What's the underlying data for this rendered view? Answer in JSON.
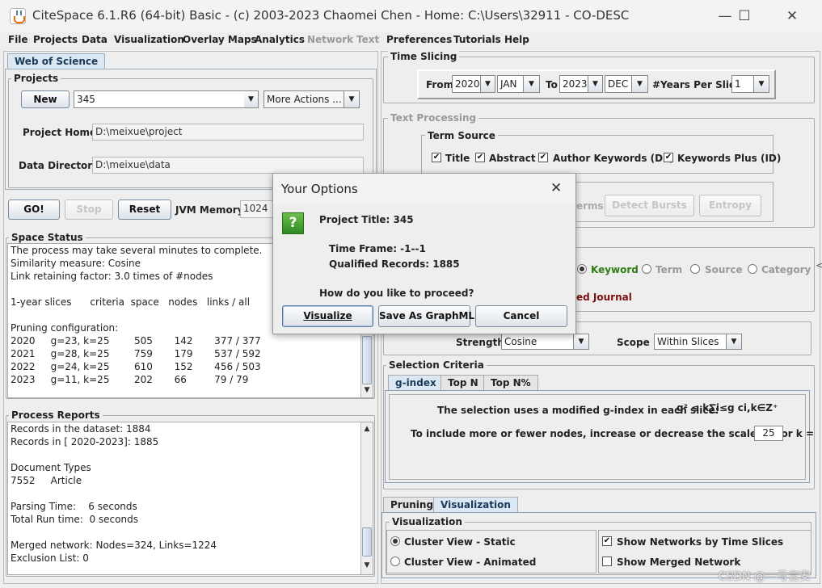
{
  "window": {
    "title": "CiteSpace 6.1.R6 (64-bit) Basic - (c) 2003-2023 Chaomei Chen - Home: C:\\Users\\32911 - CO-DESC",
    "minimize": "—",
    "maximize": "☐",
    "close": "✕"
  },
  "menu": [
    "File",
    "Projects",
    "Data",
    "Visualization",
    "Overlay Maps",
    "Analytics",
    "Network",
    "Text",
    "Preferences",
    "Tutorials",
    "Help"
  ],
  "left": {
    "tab": "Web of Science",
    "projects": {
      "title": "Projects",
      "new_label": "New",
      "project_value": "345",
      "more_actions": "More Actions ...",
      "home_label": "Project Home:",
      "home_value": "D:\\meixue\\project",
      "data_label": "Data Directory:",
      "data_value": "D:\\meixue\\data"
    },
    "controls": {
      "go": "GO!",
      "stop": "Stop",
      "reset": "Reset",
      "jvm_label": "JVM Memory",
      "jvm_value": "1024"
    },
    "space_status": {
      "title": "Space Status",
      "lines": [
        "The process may take several minutes to complete.",
        "Similarity measure: Cosine",
        "Link retaining factor: 3.0 times of #nodes",
        "",
        "1-year slices      criteria  space   nodes   links / all",
        "",
        "Pruning configuration:",
        "2020     g=23, k=25        505       142       377 / 377",
        "2021     g=28, k=25        759       179       537 / 592",
        "2022     g=24, k=25        610       152       456 / 503",
        "2023     g=11, k=25        202       66         79 / 79"
      ]
    },
    "process_reports": {
      "title": "Process Reports",
      "lines": [
        "Records in the dataset: 1884",
        "Records in [ 2020-2023]: 1885",
        "",
        "Document Types",
        "7552     Article",
        "",
        "Parsing Time:    6 seconds",
        "Total Run time:  0 seconds",
        "",
        "Merged network: Nodes=324, Links=1224",
        "Exclusion List: 0"
      ]
    }
  },
  "right": {
    "time_slicing": {
      "title": "Time Slicing",
      "from_label": "From",
      "from_year": "2020",
      "from_month": "JAN",
      "to_label": "To",
      "to_year": "2023",
      "to_month": "DEC",
      "years_label": "#Years Per Slice",
      "years_value": "1"
    },
    "text_processing": {
      "title": "Text Processing",
      "term_source": "Term Source",
      "title_cb": "Title",
      "abstract_cb": "Abstract",
      "author_kw_cb": "Author Keywords (DE)",
      "kw_plus_cb": "Keywords Plus (ID)",
      "terms_partial": "erms",
      "detect_bursts": "Detect Bursts",
      "entropy": "Entropy"
    },
    "node_types": {
      "keyword": "Keyword",
      "term": "Term",
      "source": "Source",
      "category": "Category",
      "cited_journal": "ed Journal"
    },
    "links": {
      "strength_label": "Strength",
      "strength_value": "Cosine",
      "scope_label": "Scope",
      "scope_value": "Within Slices"
    },
    "selection": {
      "title": "Selection Criteria",
      "tabs": [
        "g-index",
        "Top N",
        "Top N%"
      ],
      "sentence": "The selection uses a modified g-index in each slice:",
      "formula": "g² ≤ k∑i≤g ci,k∈Z⁺",
      "scale_text": "To include more or fewer nodes, increase or decrease the scale factor k =",
      "k_value": "25"
    },
    "bottom_tabs": [
      "Pruning",
      "Visualization"
    ],
    "visualization": {
      "title": "Visualization",
      "static": "Cluster View - Static",
      "animated": "Cluster View - Animated",
      "by_slices": "Show Networks by Time Slices",
      "merged": "Show Merged Network"
    }
  },
  "dialog": {
    "title": "Your Options",
    "close": "✕",
    "icon": "question-icon",
    "project_title": "Project Title: 345",
    "time_frame": "Time Frame: -1--1",
    "qualified": "Qualified Records: 1885",
    "prompt": "How do you like to proceed?",
    "visualize": "Visualize",
    "save_graphml": "Save As GraphML",
    "cancel": "Cancel"
  },
  "watermark": "CSDN @一号言安"
}
